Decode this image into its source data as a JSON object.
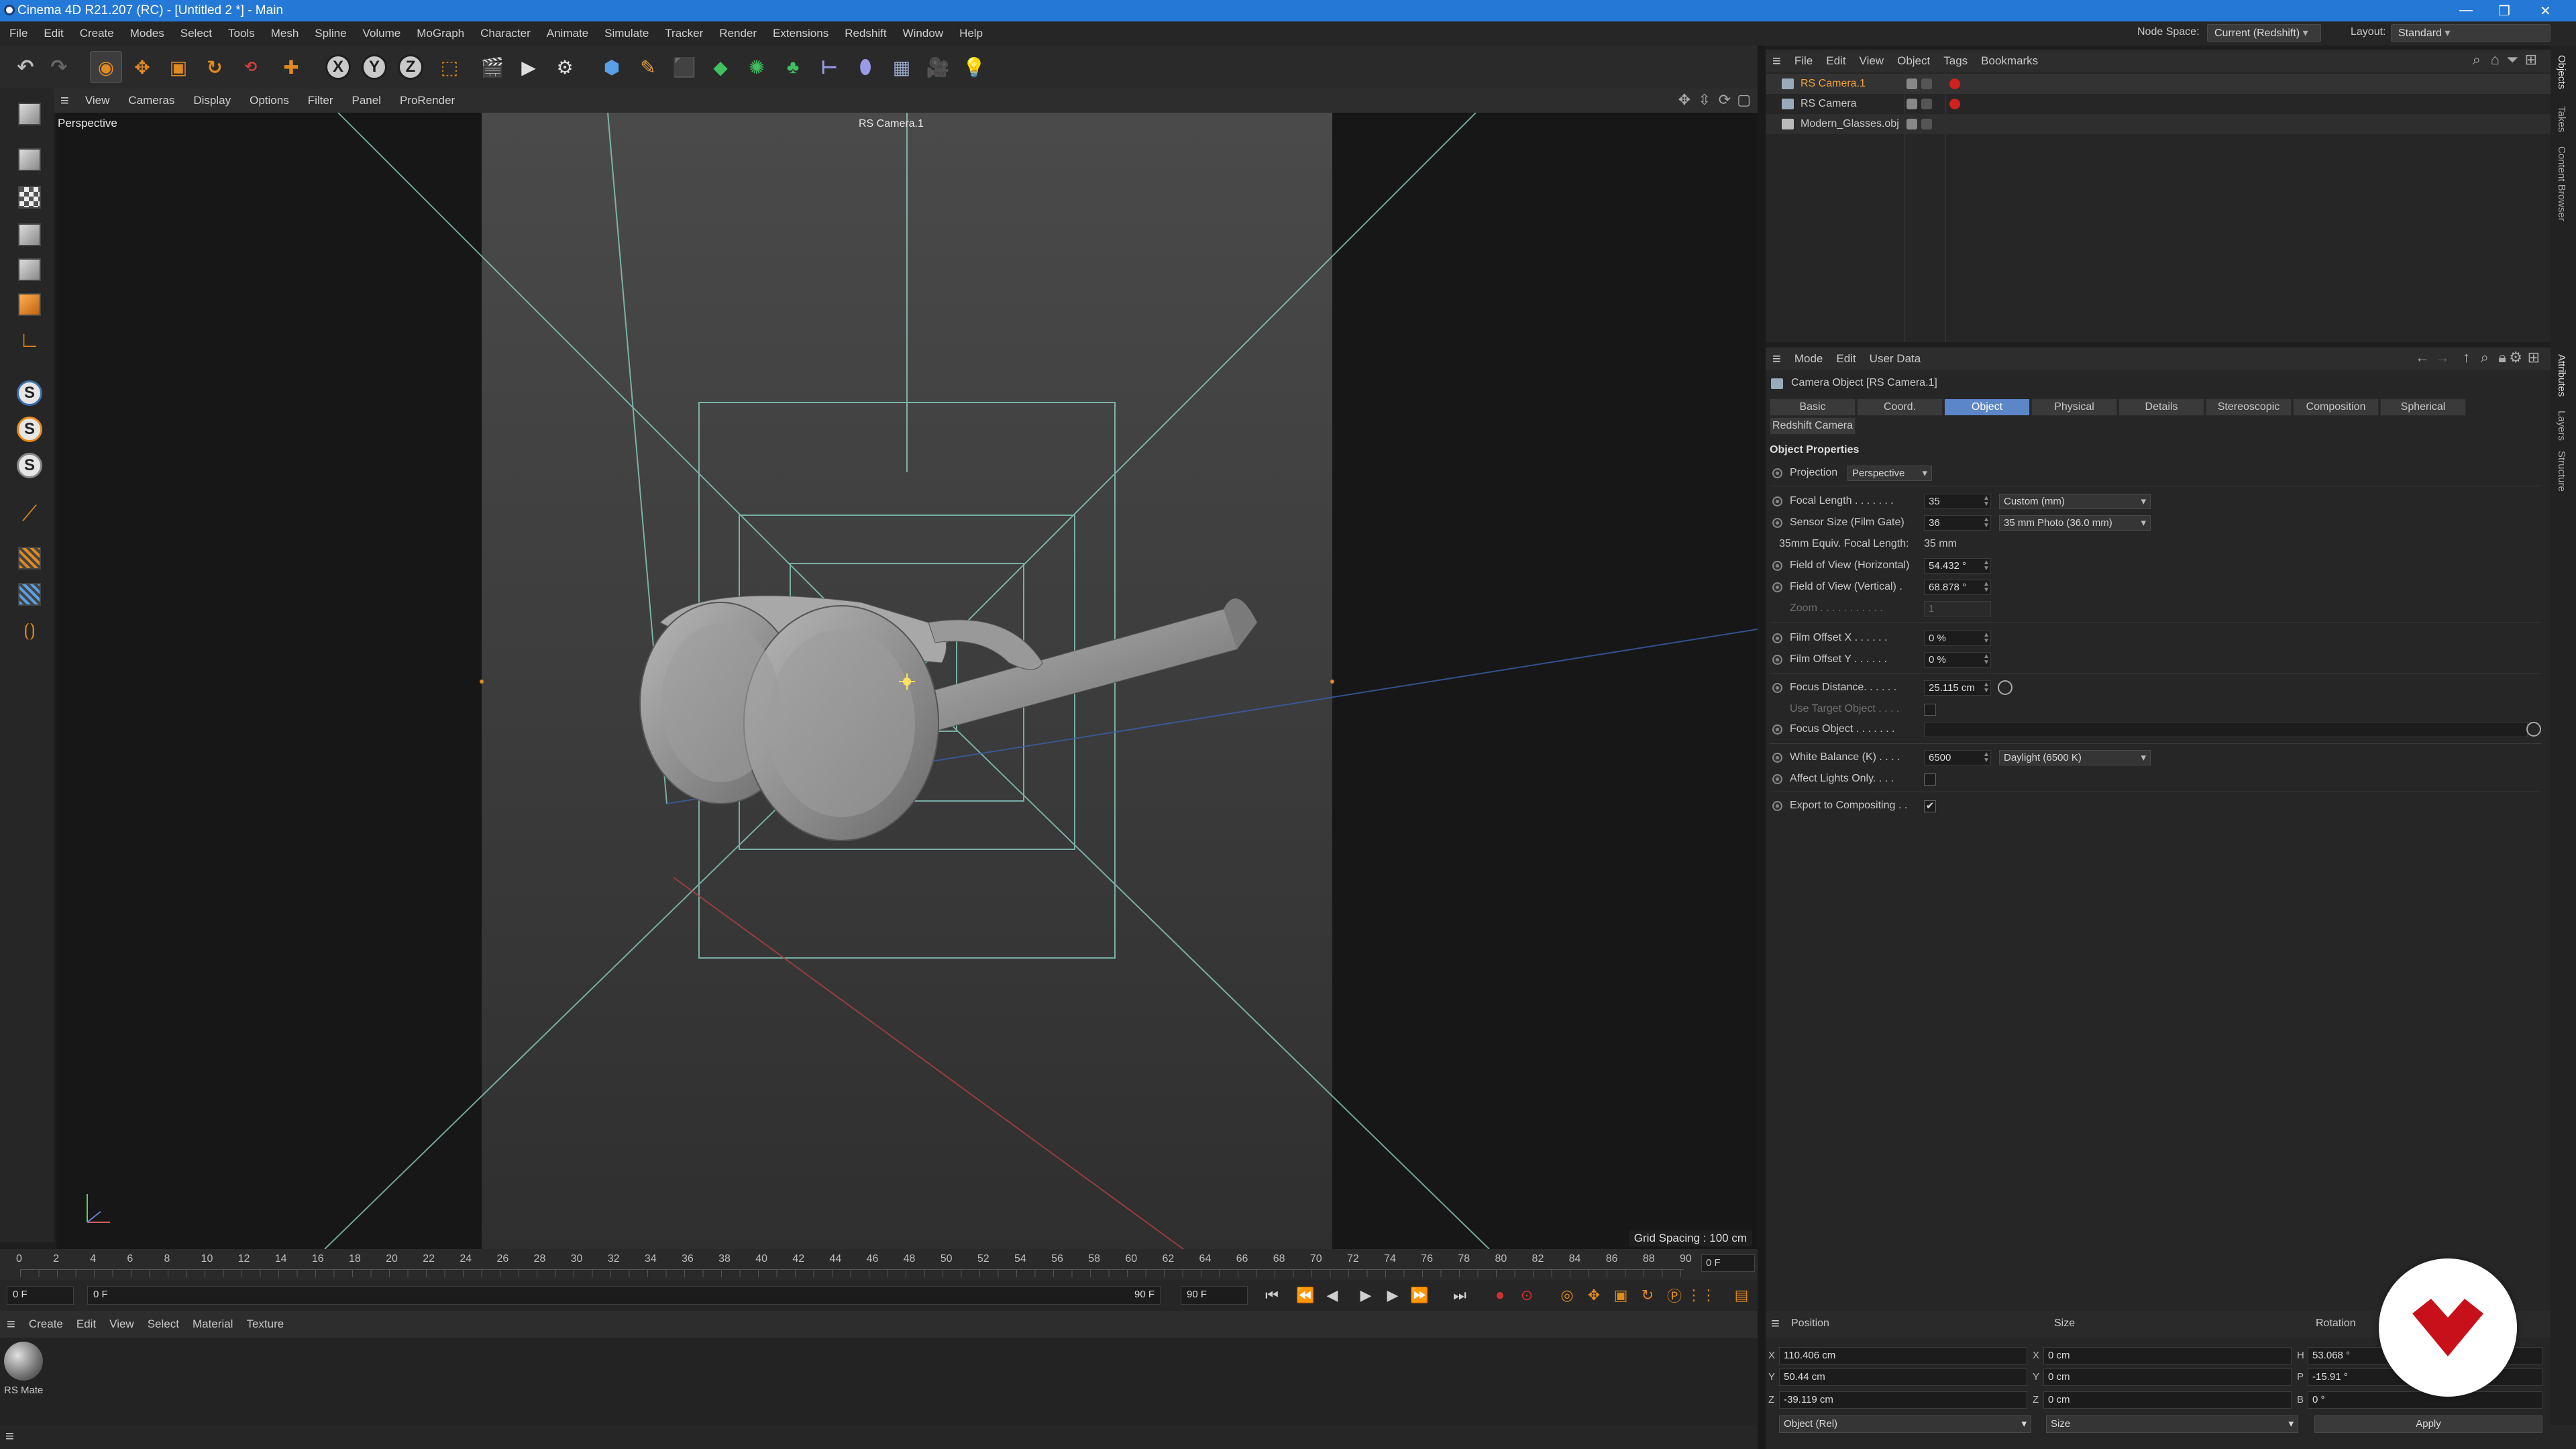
{
  "titlebar": {
    "title": "Cinema 4D R21.207 (RC) - [Untitled 2 *] - Main",
    "minimize": "—",
    "restore": "❐",
    "close": "✕"
  },
  "menubar": {
    "items": [
      "File",
      "Edit",
      "Create",
      "Modes",
      "Select",
      "Tools",
      "Mesh",
      "Spline",
      "Volume",
      "MoGraph",
      "Character",
      "Animate",
      "Simulate",
      "Tracker",
      "Render",
      "Extensions",
      "Redshift",
      "Window",
      "Help"
    ],
    "node_space_label": "Node Space:",
    "node_space_value": "Current (Redshift)",
    "layout_label": "Layout:",
    "layout_value": "Standard"
  },
  "toolbar": {
    "axis_x": "X",
    "axis_y": "Y",
    "axis_z": "Z"
  },
  "lefttools": {
    "s1": "S",
    "s2": "S",
    "s3": "S"
  },
  "viewport": {
    "menu": [
      "View",
      "Cameras",
      "Display",
      "Options",
      "Filter",
      "Panel",
      "ProRender"
    ],
    "view_name": "Perspective",
    "camera_name": "RS Camera.1",
    "grid_spacing": "Grid Spacing : 100 cm"
  },
  "timeline": {
    "ticks": [
      "0",
      "2",
      "4",
      "6",
      "8",
      "10",
      "12",
      "14",
      "16",
      "18",
      "20",
      "22",
      "24",
      "26",
      "28",
      "30",
      "32",
      "34",
      "36",
      "38",
      "40",
      "42",
      "44",
      "46",
      "48",
      "50",
      "52",
      "54",
      "56",
      "58",
      "60",
      "62",
      "64",
      "66",
      "68",
      "70",
      "72",
      "74",
      "76",
      "78",
      "80",
      "82",
      "84",
      "86",
      "88",
      "90"
    ],
    "current_frame": "0 F"
  },
  "transport": {
    "start": "0 F",
    "min": "0 F",
    "max": "90 F",
    "end": "90 F"
  },
  "material_manager": {
    "menu": [
      "Create",
      "Edit",
      "View",
      "Select",
      "Material",
      "Texture"
    ],
    "material_name": "RS Mate"
  },
  "object_manager": {
    "menu": [
      "File",
      "Edit",
      "View",
      "Object",
      "Tags",
      "Bookmarks"
    ],
    "objects": [
      {
        "name": "RS Camera.1",
        "selected": true
      },
      {
        "name": "RS Camera",
        "selected": false
      },
      {
        "name": "Modern_Glasses.obj",
        "selected": false
      }
    ]
  },
  "attribute_manager": {
    "menu": [
      "Mode",
      "Edit",
      "User Data"
    ],
    "object_title": "Camera Object [RS Camera.1]",
    "tabs": [
      "Basic",
      "Coord.",
      "Object",
      "Physical",
      "Details",
      "Stereoscopic",
      "Composition",
      "Spherical"
    ],
    "active_tab": "Object",
    "tab2": "Redshift Camera",
    "section": "Object Properties",
    "projection_label": "Projection",
    "projection_value": "Perspective",
    "focal_length_label": "Focal Length . . . . . . .",
    "focal_length_value": "35",
    "focal_length_preset": "Custom (mm)",
    "sensor_label": "Sensor Size (Film Gate)",
    "sensor_value": "36",
    "sensor_preset": "35 mm Photo (36.0 mm)",
    "equiv_label": "35mm Equiv. Focal Length:",
    "equiv_value": "35 mm",
    "fovh_label": "Field of View (Horizontal)",
    "fovh_value": "54.432 °",
    "fovv_label": "Field of View (Vertical) .",
    "fovv_value": "68.878 °",
    "zoom_label": "Zoom . . . . . . . . . . .",
    "zoom_value": "1",
    "offx_label": "Film Offset X . . . . . .",
    "offx_value": "0 %",
    "offy_label": "Film Offset Y . . . . . .",
    "offy_value": "0 %",
    "focus_label": "Focus Distance. . . . . .",
    "focus_value": "25.115 cm",
    "use_target_label": "Use Target Object . . . .",
    "focus_obj_label": "Focus Object . . . . . . .",
    "wb_label": "White Balance (K) . . . .",
    "wb_value": "6500",
    "wb_preset": "Daylight (6500 K)",
    "affect_label": "Affect Lights Only. . . .",
    "export_label": "Export to Compositing . .",
    "check": "✔"
  },
  "coordinates": {
    "position_label": "Position",
    "size_label": "Size",
    "rotation_label": "Rotation",
    "px": "110.406 cm",
    "py": "50.44 cm",
    "pz": "-39.119 cm",
    "sx": "0 cm",
    "sy": "0 cm",
    "sz": "0 cm",
    "rh": "53.068 °",
    "rp": "-15.91 °",
    "rb": "0 °",
    "lx": "X",
    "ly": "Y",
    "lz": "Z",
    "lsx": "X",
    "lsy": "Y",
    "lsz": "Z",
    "lh": "H",
    "lp": "P",
    "lb": "B",
    "mode": "Object (Rel)",
    "size_mode": "Size",
    "apply": "Apply"
  },
  "sidetabs": [
    "Objects",
    "Takes",
    "Content Browser",
    "Attributes",
    "Layers",
    "Structure"
  ],
  "colors": {
    "accent": "#5b86c7",
    "titlebar": "#2478d6",
    "selected_object": "#f0a040",
    "logo": "#c8101a"
  }
}
